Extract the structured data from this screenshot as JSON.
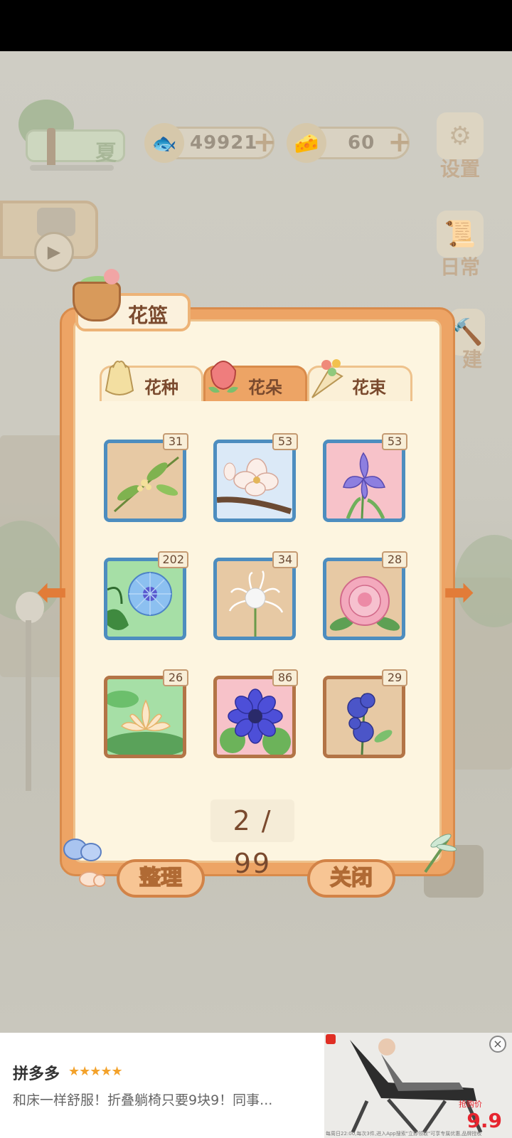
{
  "hud": {
    "season_label": "夏",
    "fish_count": "49921",
    "cheese_count": "60",
    "plus_symbol": "+",
    "settings_label": "设置",
    "daily_label": "日常",
    "build_label": "建"
  },
  "panel": {
    "title": "花篮",
    "tabs": [
      {
        "label": "花种",
        "active": false
      },
      {
        "label": "花朵",
        "active": true
      },
      {
        "label": "花束",
        "active": false
      }
    ],
    "flowers": [
      {
        "count": "31",
        "bg": "#e7c9a4",
        "frame": "blue",
        "flower": "osmanthus"
      },
      {
        "count": "53",
        "bg": "#dbe9f7",
        "frame": "blue",
        "flower": "magnolia"
      },
      {
        "count": "53",
        "bg": "#f7c2c9",
        "frame": "blue",
        "flower": "iris"
      },
      {
        "count": "202",
        "bg": "#a6dfa6",
        "frame": "blue",
        "flower": "morning-glory"
      },
      {
        "count": "34",
        "bg": "#e7c9a4",
        "frame": "blue",
        "flower": "spider-lily"
      },
      {
        "count": "28",
        "bg": "#e7c9a4",
        "frame": "blue",
        "flower": "peony"
      },
      {
        "count": "26",
        "bg": "#a6dfa6",
        "frame": "brown",
        "flower": "lotus"
      },
      {
        "count": "86",
        "bg": "#f7c2c9",
        "frame": "brown",
        "flower": "anemone"
      },
      {
        "count": "29",
        "bg": "#e7c9a4",
        "frame": "brown",
        "flower": "bellflower"
      }
    ],
    "page_indicator": "2 / 99",
    "sort_button": "整理",
    "close_button": "关闭",
    "prev_arrow": "⬅",
    "next_arrow": "➡"
  },
  "ad": {
    "brand": "拼多多",
    "stars": "★★★★★",
    "description": "和床一样舒服！折叠躺椅只要9块9！同事...",
    "price_tag": "抢购价",
    "price": "9.9",
    "fine_print": "每周日22:00,每次3件,进入App搜索\"立即领取\"可享专属优惠,品牌授权",
    "close_symbol": "×"
  },
  "colors": {
    "panel_orange": "#eda465",
    "panel_cream": "#fdf5e0",
    "frame_blue": "#4d8dbf",
    "frame_brown": "#b37446",
    "arrow_orange": "#e27c38"
  }
}
